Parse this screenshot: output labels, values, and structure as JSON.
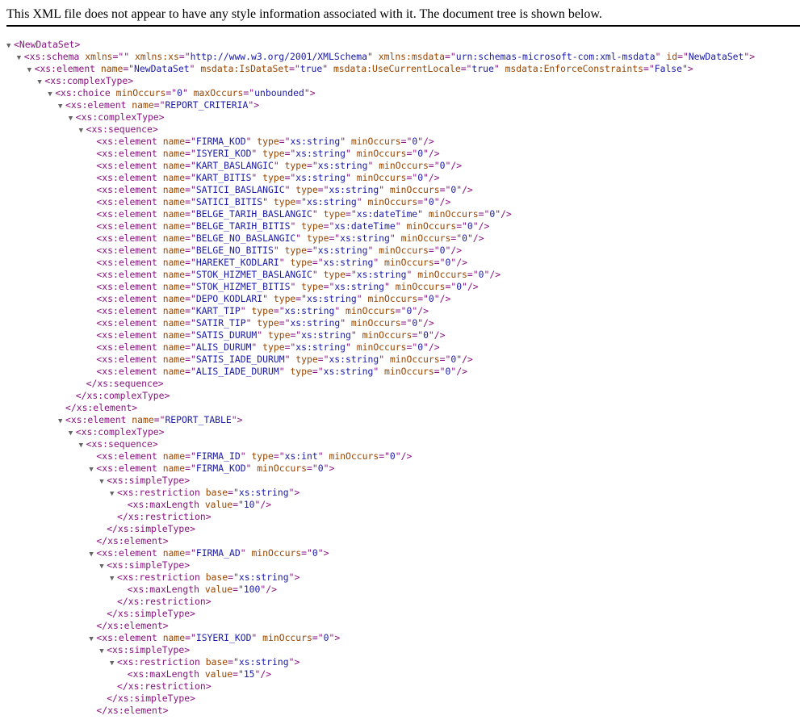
{
  "header": {
    "message": "This XML file does not appear to have any style information associated with it. The document tree is shown below."
  },
  "tree": [
    {
      "indent": 0,
      "toggle": true,
      "kind": "open",
      "tag": "NewDataSet",
      "attrs": []
    },
    {
      "indent": 1,
      "toggle": true,
      "kind": "open",
      "tag": "xs:schema",
      "attrs": [
        [
          "xmlns",
          ""
        ],
        [
          "xmlns:xs",
          "http://www.w3.org/2001/XMLSchema"
        ],
        [
          "xmlns:msdata",
          "urn:schemas-microsoft-com:xml-msdata"
        ],
        [
          "id",
          "NewDataSet"
        ]
      ]
    },
    {
      "indent": 2,
      "toggle": true,
      "kind": "open",
      "tag": "xs:element",
      "attrs": [
        [
          "name",
          "NewDataSet"
        ],
        [
          "msdata:IsDataSet",
          "true"
        ],
        [
          "msdata:UseCurrentLocale",
          "true"
        ],
        [
          "msdata:EnforceConstraints",
          "False"
        ]
      ]
    },
    {
      "indent": 3,
      "toggle": true,
      "kind": "open",
      "tag": "xs:complexType",
      "attrs": []
    },
    {
      "indent": 4,
      "toggle": true,
      "kind": "open",
      "tag": "xs:choice",
      "attrs": [
        [
          "minOccurs",
          "0"
        ],
        [
          "maxOccurs",
          "unbounded"
        ]
      ]
    },
    {
      "indent": 5,
      "toggle": true,
      "kind": "open",
      "tag": "xs:element",
      "attrs": [
        [
          "name",
          "REPORT_CRITERIA"
        ]
      ]
    },
    {
      "indent": 6,
      "toggle": true,
      "kind": "open",
      "tag": "xs:complexType",
      "attrs": []
    },
    {
      "indent": 7,
      "toggle": true,
      "kind": "open",
      "tag": "xs:sequence",
      "attrs": []
    },
    {
      "indent": 8,
      "toggle": false,
      "kind": "self",
      "tag": "xs:element",
      "attrs": [
        [
          "name",
          "FIRMA_KOD"
        ],
        [
          "type",
          "xs:string"
        ],
        [
          "minOccurs",
          "0"
        ]
      ]
    },
    {
      "indent": 8,
      "toggle": false,
      "kind": "self",
      "tag": "xs:element",
      "attrs": [
        [
          "name",
          "ISYERI_KOD"
        ],
        [
          "type",
          "xs:string"
        ],
        [
          "minOccurs",
          "0"
        ]
      ]
    },
    {
      "indent": 8,
      "toggle": false,
      "kind": "self",
      "tag": "xs:element",
      "attrs": [
        [
          "name",
          "KART_BASLANGIC"
        ],
        [
          "type",
          "xs:string"
        ],
        [
          "minOccurs",
          "0"
        ]
      ]
    },
    {
      "indent": 8,
      "toggle": false,
      "kind": "self",
      "tag": "xs:element",
      "attrs": [
        [
          "name",
          "KART_BITIS"
        ],
        [
          "type",
          "xs:string"
        ],
        [
          "minOccurs",
          "0"
        ]
      ]
    },
    {
      "indent": 8,
      "toggle": false,
      "kind": "self",
      "tag": "xs:element",
      "attrs": [
        [
          "name",
          "SATICI_BASLANGIC"
        ],
        [
          "type",
          "xs:string"
        ],
        [
          "minOccurs",
          "0"
        ]
      ]
    },
    {
      "indent": 8,
      "toggle": false,
      "kind": "self",
      "tag": "xs:element",
      "attrs": [
        [
          "name",
          "SATICI_BITIS"
        ],
        [
          "type",
          "xs:string"
        ],
        [
          "minOccurs",
          "0"
        ]
      ]
    },
    {
      "indent": 8,
      "toggle": false,
      "kind": "self",
      "tag": "xs:element",
      "attrs": [
        [
          "name",
          "BELGE_TARIH_BASLANGIC"
        ],
        [
          "type",
          "xs:dateTime"
        ],
        [
          "minOccurs",
          "0"
        ]
      ]
    },
    {
      "indent": 8,
      "toggle": false,
      "kind": "self",
      "tag": "xs:element",
      "attrs": [
        [
          "name",
          "BELGE_TARIH_BITIS"
        ],
        [
          "type",
          "xs:dateTime"
        ],
        [
          "minOccurs",
          "0"
        ]
      ]
    },
    {
      "indent": 8,
      "toggle": false,
      "kind": "self",
      "tag": "xs:element",
      "attrs": [
        [
          "name",
          "BELGE_NO_BASLANGIC"
        ],
        [
          "type",
          "xs:string"
        ],
        [
          "minOccurs",
          "0"
        ]
      ]
    },
    {
      "indent": 8,
      "toggle": false,
      "kind": "self",
      "tag": "xs:element",
      "attrs": [
        [
          "name",
          "BELGE_NO_BITIS"
        ],
        [
          "type",
          "xs:string"
        ],
        [
          "minOccurs",
          "0"
        ]
      ]
    },
    {
      "indent": 8,
      "toggle": false,
      "kind": "self",
      "tag": "xs:element",
      "attrs": [
        [
          "name",
          "HAREKET_KODLARI"
        ],
        [
          "type",
          "xs:string"
        ],
        [
          "minOccurs",
          "0"
        ]
      ]
    },
    {
      "indent": 8,
      "toggle": false,
      "kind": "self",
      "tag": "xs:element",
      "attrs": [
        [
          "name",
          "STOK_HIZMET_BASLANGIC"
        ],
        [
          "type",
          "xs:string"
        ],
        [
          "minOccurs",
          "0"
        ]
      ]
    },
    {
      "indent": 8,
      "toggle": false,
      "kind": "self",
      "tag": "xs:element",
      "attrs": [
        [
          "name",
          "STOK_HIZMET_BITIS"
        ],
        [
          "type",
          "xs:string"
        ],
        [
          "minOccurs",
          "0"
        ]
      ]
    },
    {
      "indent": 8,
      "toggle": false,
      "kind": "self",
      "tag": "xs:element",
      "attrs": [
        [
          "name",
          "DEPO_KODLARI"
        ],
        [
          "type",
          "xs:string"
        ],
        [
          "minOccurs",
          "0"
        ]
      ]
    },
    {
      "indent": 8,
      "toggle": false,
      "kind": "self",
      "tag": "xs:element",
      "attrs": [
        [
          "name",
          "KART_TIP"
        ],
        [
          "type",
          "xs:string"
        ],
        [
          "minOccurs",
          "0"
        ]
      ]
    },
    {
      "indent": 8,
      "toggle": false,
      "kind": "self",
      "tag": "xs:element",
      "attrs": [
        [
          "name",
          "SATIR_TIP"
        ],
        [
          "type",
          "xs:string"
        ],
        [
          "minOccurs",
          "0"
        ]
      ]
    },
    {
      "indent": 8,
      "toggle": false,
      "kind": "self",
      "tag": "xs:element",
      "attrs": [
        [
          "name",
          "SATIS_DURUM"
        ],
        [
          "type",
          "xs:string"
        ],
        [
          "minOccurs",
          "0"
        ]
      ]
    },
    {
      "indent": 8,
      "toggle": false,
      "kind": "self",
      "tag": "xs:element",
      "attrs": [
        [
          "name",
          "ALIS_DURUM"
        ],
        [
          "type",
          "xs:string"
        ],
        [
          "minOccurs",
          "0"
        ]
      ]
    },
    {
      "indent": 8,
      "toggle": false,
      "kind": "self",
      "tag": "xs:element",
      "attrs": [
        [
          "name",
          "SATIS_IADE_DURUM"
        ],
        [
          "type",
          "xs:string"
        ],
        [
          "minOccurs",
          "0"
        ]
      ]
    },
    {
      "indent": 8,
      "toggle": false,
      "kind": "self",
      "tag": "xs:element",
      "attrs": [
        [
          "name",
          "ALIS_IADE_DURUM"
        ],
        [
          "type",
          "xs:string"
        ],
        [
          "minOccurs",
          "0"
        ]
      ]
    },
    {
      "indent": 7,
      "toggle": false,
      "kind": "close",
      "tag": "xs:sequence",
      "attrs": []
    },
    {
      "indent": 6,
      "toggle": false,
      "kind": "close",
      "tag": "xs:complexType",
      "attrs": []
    },
    {
      "indent": 5,
      "toggle": false,
      "kind": "close",
      "tag": "xs:element",
      "attrs": []
    },
    {
      "indent": 5,
      "toggle": true,
      "kind": "open",
      "tag": "xs:element",
      "attrs": [
        [
          "name",
          "REPORT_TABLE"
        ]
      ]
    },
    {
      "indent": 6,
      "toggle": true,
      "kind": "open",
      "tag": "xs:complexType",
      "attrs": []
    },
    {
      "indent": 7,
      "toggle": true,
      "kind": "open",
      "tag": "xs:sequence",
      "attrs": []
    },
    {
      "indent": 8,
      "toggle": false,
      "kind": "self",
      "tag": "xs:element",
      "attrs": [
        [
          "name",
          "FIRMA_ID"
        ],
        [
          "type",
          "xs:int"
        ],
        [
          "minOccurs",
          "0"
        ]
      ]
    },
    {
      "indent": 8,
      "toggle": true,
      "kind": "open",
      "tag": "xs:element",
      "attrs": [
        [
          "name",
          "FIRMA_KOD"
        ],
        [
          "minOccurs",
          "0"
        ]
      ]
    },
    {
      "indent": 9,
      "toggle": true,
      "kind": "open",
      "tag": "xs:simpleType",
      "attrs": []
    },
    {
      "indent": 10,
      "toggle": true,
      "kind": "open",
      "tag": "xs:restriction",
      "attrs": [
        [
          "base",
          "xs:string"
        ]
      ]
    },
    {
      "indent": 11,
      "toggle": false,
      "kind": "self",
      "tag": "xs:maxLength",
      "attrs": [
        [
          "value",
          "10"
        ]
      ]
    },
    {
      "indent": 10,
      "toggle": false,
      "kind": "close",
      "tag": "xs:restriction",
      "attrs": []
    },
    {
      "indent": 9,
      "toggle": false,
      "kind": "close",
      "tag": "xs:simpleType",
      "attrs": []
    },
    {
      "indent": 8,
      "toggle": false,
      "kind": "close",
      "tag": "xs:element",
      "attrs": []
    },
    {
      "indent": 8,
      "toggle": true,
      "kind": "open",
      "tag": "xs:element",
      "attrs": [
        [
          "name",
          "FIRMA_AD"
        ],
        [
          "minOccurs",
          "0"
        ]
      ]
    },
    {
      "indent": 9,
      "toggle": true,
      "kind": "open",
      "tag": "xs:simpleType",
      "attrs": []
    },
    {
      "indent": 10,
      "toggle": true,
      "kind": "open",
      "tag": "xs:restriction",
      "attrs": [
        [
          "base",
          "xs:string"
        ]
      ]
    },
    {
      "indent": 11,
      "toggle": false,
      "kind": "self",
      "tag": "xs:maxLength",
      "attrs": [
        [
          "value",
          "100"
        ]
      ]
    },
    {
      "indent": 10,
      "toggle": false,
      "kind": "close",
      "tag": "xs:restriction",
      "attrs": []
    },
    {
      "indent": 9,
      "toggle": false,
      "kind": "close",
      "tag": "xs:simpleType",
      "attrs": []
    },
    {
      "indent": 8,
      "toggle": false,
      "kind": "close",
      "tag": "xs:element",
      "attrs": []
    },
    {
      "indent": 8,
      "toggle": true,
      "kind": "open",
      "tag": "xs:element",
      "attrs": [
        [
          "name",
          "ISYERI_KOD"
        ],
        [
          "minOccurs",
          "0"
        ]
      ]
    },
    {
      "indent": 9,
      "toggle": true,
      "kind": "open",
      "tag": "xs:simpleType",
      "attrs": []
    },
    {
      "indent": 10,
      "toggle": true,
      "kind": "open",
      "tag": "xs:restriction",
      "attrs": [
        [
          "base",
          "xs:string"
        ]
      ]
    },
    {
      "indent": 11,
      "toggle": false,
      "kind": "self",
      "tag": "xs:maxLength",
      "attrs": [
        [
          "value",
          "15"
        ]
      ]
    },
    {
      "indent": 10,
      "toggle": false,
      "kind": "close",
      "tag": "xs:restriction",
      "attrs": []
    },
    {
      "indent": 9,
      "toggle": false,
      "kind": "close",
      "tag": "xs:simpleType",
      "attrs": []
    },
    {
      "indent": 8,
      "toggle": false,
      "kind": "close",
      "tag": "xs:element",
      "attrs": []
    }
  ]
}
